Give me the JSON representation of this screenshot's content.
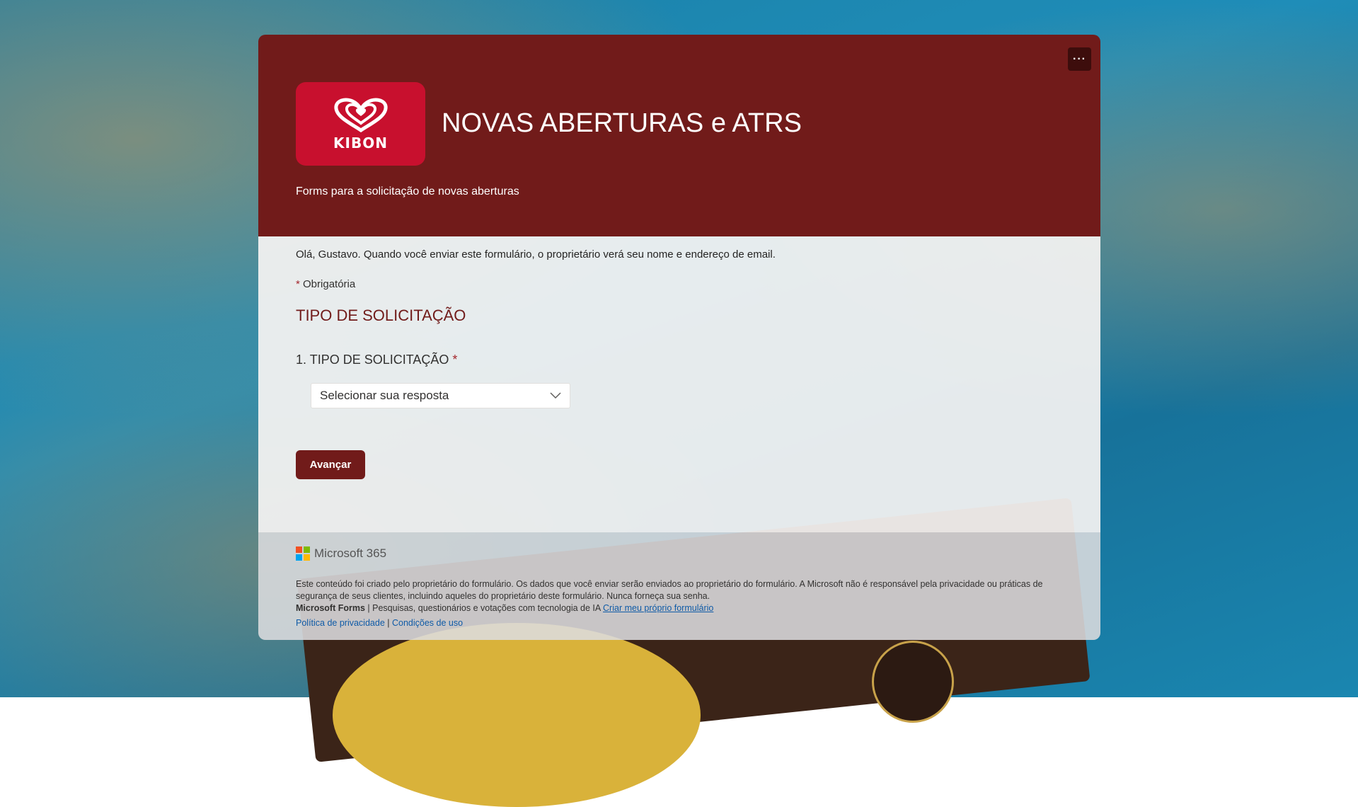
{
  "header": {
    "title": "NOVAS ABERTURAS e ATRS",
    "subtitle": "Forms para a solicitação de novas aberturas",
    "logo_text": "KIBON",
    "more_label": "···"
  },
  "body": {
    "greeting": "Olá, Gustavo. Quando você enviar este formulário, o proprietário verá seu nome e endereço de email.",
    "required_asterisk": "*",
    "required_label": "Obrigatória",
    "section_title": "TIPO DE SOLICITAÇÃO",
    "question": {
      "number": "1.",
      "label": "TIPO DE SOLICITAÇÃO",
      "asterisk": "*",
      "select_placeholder": "Selecionar sua resposta"
    },
    "next_label": "Avançar"
  },
  "footer": {
    "brand": "Microsoft 365",
    "disclaimer": "Este conteúdo foi criado pelo proprietário do formulário. Os dados que você enviar serão enviados ao proprietário do formulário. A Microsoft não é responsável pela privacidade ou práticas de segurança de seus clientes, incluindo aqueles do proprietário deste formulário. Nunca forneça sua senha.",
    "forms_brand": "Microsoft Forms",
    "forms_tagline": " | Pesquisas, questionários e votações com tecnologia de IA ",
    "create_link": "Criar meu próprio formulário",
    "privacy_link": "Política de privacidade",
    "separator": " | ",
    "terms_link": "Condições de uso"
  },
  "colors": {
    "header_bg": "#711b1a",
    "accent": "#711b1a",
    "logo_bg": "#c8102e",
    "required": "#a4262c",
    "link": "#0f5ba7"
  },
  "icons": {
    "more": "more-horizontal-icon",
    "select": "chevron-down-icon",
    "microsoft": "microsoft-logo-icon",
    "kibon": "kibon-heart-logo"
  }
}
